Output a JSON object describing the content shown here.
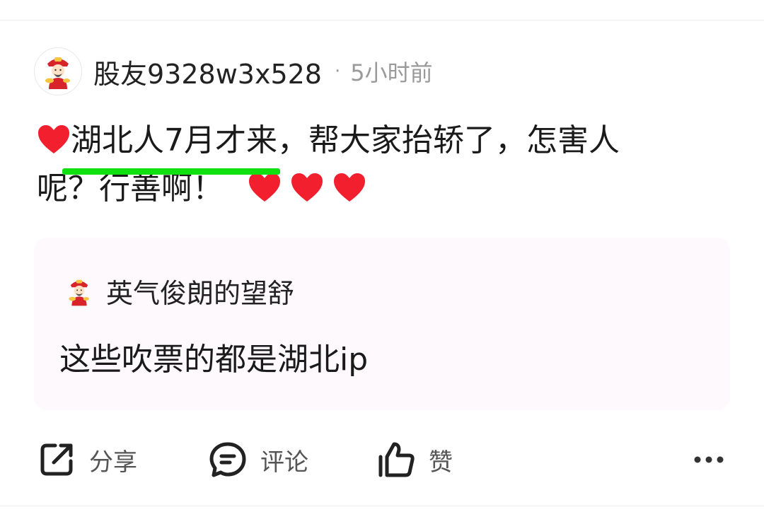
{
  "post": {
    "username": "股友9328w3x528",
    "separator": "·",
    "time": "5小时前",
    "body": {
      "highlighted": "湖北人7月才来",
      "line1_rest": "，帮大家抬轿了，怎害人",
      "line2": "呢？行善啊！"
    },
    "highlight_color": "#10e010",
    "heart_color": "#f2202e"
  },
  "quote": {
    "username": "英气俊朗的望舒",
    "text": "这些吹票的都是湖北ip"
  },
  "actions": {
    "share_label": "分享",
    "comment_label": "评论",
    "like_label": "赞",
    "share_icon": "share-icon",
    "comment_icon": "comment-icon",
    "like_icon": "thumbs-up-icon",
    "more_icon": "more-icon"
  }
}
